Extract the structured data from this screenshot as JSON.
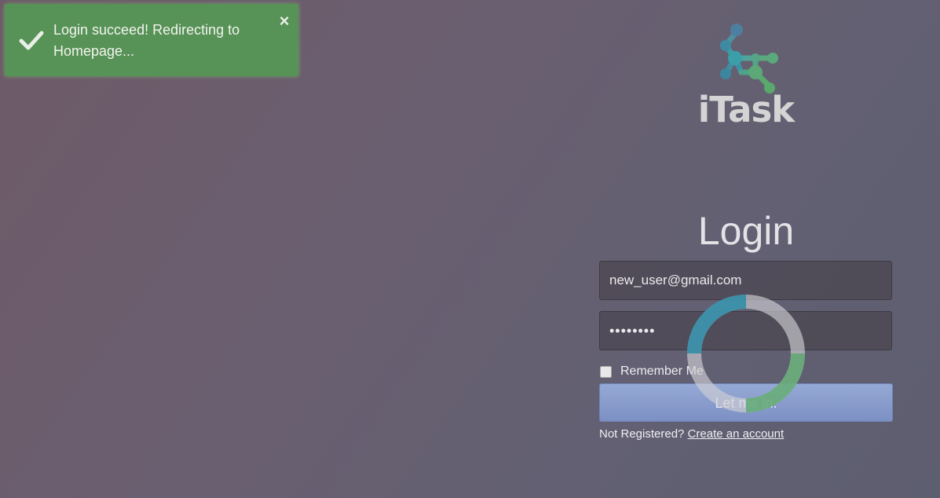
{
  "toast": {
    "message": "Login succeed! Redirecting to Homepage...",
    "close_symbol": "×",
    "icon": "check-icon",
    "color": "#579256"
  },
  "brand": {
    "name": "iTask",
    "logo_icon": "molecule-logo-icon"
  },
  "login": {
    "title": "Login",
    "email_value": "new_user@gmail.com",
    "password_value": "••••••••",
    "remember_label": "Remember Me",
    "remember_checked": false,
    "submit_label": "Let me in.",
    "register_prompt": "Not Registered?",
    "register_link": "Create an account"
  },
  "colors": {
    "button": "#7d90c4",
    "spinner_blue": "#2c8ba6",
    "spinner_green": "#5aa86e",
    "spinner_track": "#cfcfd4"
  },
  "spinner": {
    "icon": "loading-spinner-icon"
  }
}
